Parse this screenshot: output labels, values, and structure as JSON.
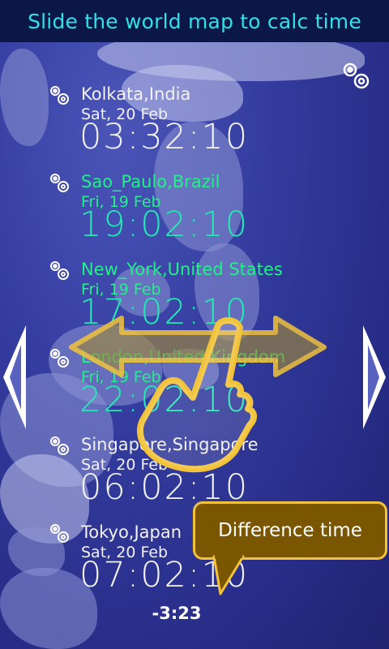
{
  "title_bar": {
    "title": "Slide the world map to calc time"
  },
  "clocks": [
    {
      "location": "Kolkata,India",
      "date": "Sat, 20 Feb",
      "time": "03:32:10",
      "style": "white"
    },
    {
      "location": "Sao_Paulo,Brazil",
      "date": "Fri, 19 Feb",
      "time": "19:02:10",
      "style": "cyan"
    },
    {
      "location": "New_York,United States",
      "date": "Fri, 19 Feb",
      "time": "17:02:10",
      "style": "cyan"
    },
    {
      "location": "London,United Kingdom",
      "date": "Fri, 19 Feb",
      "time": "22:02:10",
      "style": "cyan"
    },
    {
      "location": "Singapore,Singapore",
      "date": "Sat, 20 Feb",
      "time": "06:02:10",
      "style": "white"
    },
    {
      "location": "Tokyo,Japan",
      "date": "Sat, 20 Feb",
      "time": "07:02:10",
      "style": "white"
    }
  ],
  "difference": {
    "label": "Difference time",
    "value": "-3:23"
  },
  "icons": {
    "settings": "gear-icon",
    "clock_settings": "gear-icon",
    "prev": "left-arrow-icon",
    "next": "right-arrow-icon",
    "slide_hint": "hand-drag-icon"
  },
  "colors": {
    "title_text": "#33e0e8",
    "title_bg": "#0b1747",
    "selected_clock": "#26e7b4",
    "bubble_bg": "#7a5600",
    "bubble_border": "#f2c33a"
  }
}
